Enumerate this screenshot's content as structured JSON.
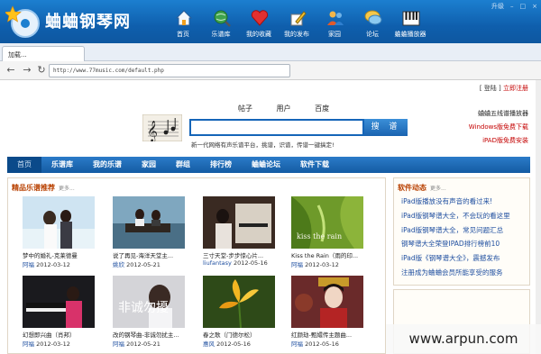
{
  "app": {
    "title": "蛐蛐钢琴网"
  },
  "window_controls": {
    "upgrade": "升级",
    "minimize": "–",
    "maximize": "□",
    "close": "×"
  },
  "topnav": [
    {
      "label": "首页",
      "icon": "home-icon"
    },
    {
      "label": "乐谱库",
      "icon": "globe-search-icon"
    },
    {
      "label": "我的收藏",
      "icon": "heart-icon"
    },
    {
      "label": "我的发布",
      "icon": "pencil-icon"
    },
    {
      "label": "家园",
      "icon": "people-icon"
    },
    {
      "label": "论坛",
      "icon": "chat-icon"
    },
    {
      "label": "蛐蛐播放器",
      "icon": "piano-keys-icon"
    }
  ],
  "tab": {
    "label": "加载..."
  },
  "address": {
    "url": "http://www.77music.com/default.php"
  },
  "page": {
    "login": "[ 登陆 ]",
    "register": "立即注册",
    "search_tabs": [
      "帖子",
      "用户",
      "百度"
    ],
    "search_button": "搜 谱",
    "slogan": "新一代网络有声乐谱平台，挑谱，识谱，传谱一键搞定!",
    "promo": [
      "蛐蛐五线谱播放器",
      "Windows版免费下载",
      "iPAD版免费安装"
    ],
    "mainnav": [
      "首页",
      "乐谱库",
      "我的乐谱",
      "家园",
      "群组",
      "排行榜",
      "蛐蛐论坛",
      "软件下载"
    ],
    "music_panel": {
      "title": "精品乐谱推荐",
      "more": "更多..."
    },
    "cards": [
      {
        "title": "梦中的婚礼-克莱德曼",
        "user": "阿福",
        "date": "2012-03-12"
      },
      {
        "title": "说了再见-海洋天堂主...",
        "user": "姚欣",
        "date": "2012-05-21"
      },
      {
        "title": "三寸天堂-步步惊心片...",
        "user": "liufantasy",
        "date": "2012-05-16"
      },
      {
        "title": "Kiss the Rain（雨的印...",
        "user": "阿福",
        "date": "2012-03-12"
      },
      {
        "title": "幻想即兴曲（肖邦）",
        "user": "阿福",
        "date": "2012-03-12"
      },
      {
        "title": "改的钢琴曲-非诚勿扰主...",
        "user": "阿福",
        "date": "2012-05-21"
      },
      {
        "title": "春之歌（门德尔松）",
        "user": "惠风",
        "date": "2012-05-16"
      },
      {
        "title": "红颜劫-甄嬛传主题曲...",
        "user": "阿福",
        "date": "2012-05-16"
      }
    ],
    "thumb_text": [
      "kiss the rain",
      "非诚勿擾"
    ],
    "soft_panel": {
      "title": "软件动态",
      "more": "更多..."
    },
    "soft_news": [
      "iPad版播放没有声音的看过来!",
      "iPad版钢琴谱大全，不会玩的看这里",
      "iPad版钢琴谱大全，常见问题汇总",
      "钢琴谱大全荣登IPAD排行榜前10",
      "iPad版《钢琴谱大全》，震撼发布",
      "注册成为蛐蛐会员所能享受的服务"
    ]
  },
  "watermark": "www.arpun.com",
  "colors": {
    "header_blue": "#0f5fad",
    "link_blue": "#1f4fa0",
    "accent_red": "#c40000",
    "panel_title": "#b84000"
  }
}
